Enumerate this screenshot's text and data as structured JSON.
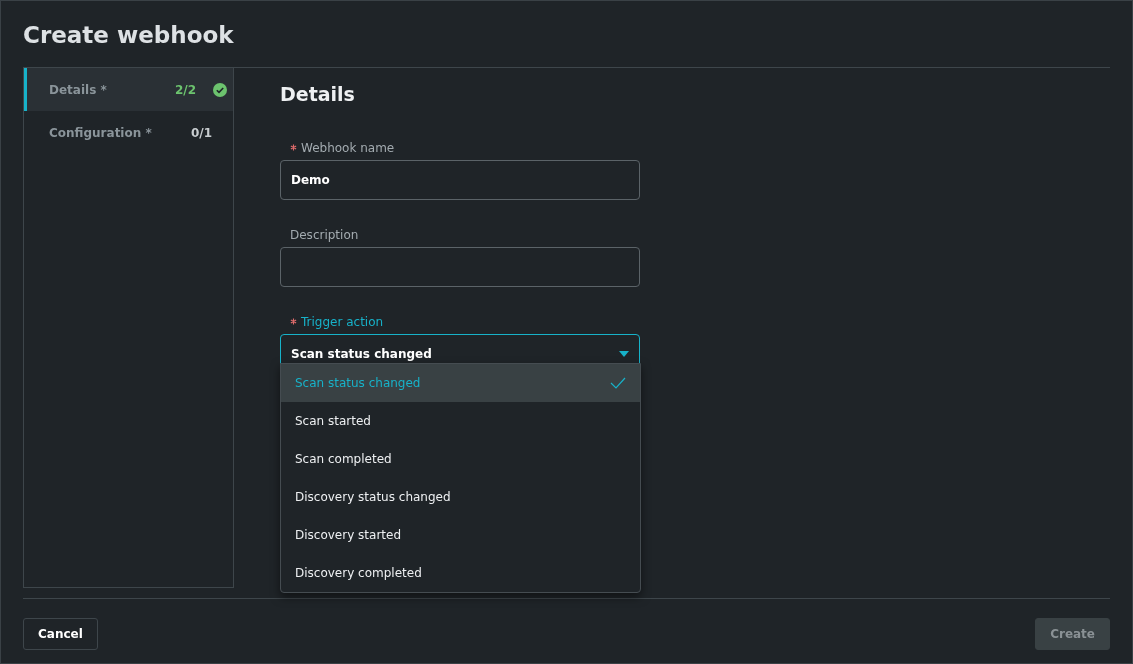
{
  "dialog": {
    "title": "Create webhook"
  },
  "steps": [
    {
      "label": "Details *",
      "count": "2/2",
      "selected": true,
      "complete": true
    },
    {
      "label": "Configuration *",
      "count": "0/1",
      "selected": false,
      "complete": false
    }
  ],
  "section_title": "Details",
  "fields": [
    {
      "kind": "text",
      "label": "Webhook name",
      "required": true,
      "focused": false,
      "value": "Demo"
    },
    {
      "kind": "text",
      "label": "Description",
      "required": false,
      "focused": false
    },
    {
      "kind": "select",
      "label": "Trigger action",
      "required": true,
      "focused": true,
      "value": "Scan status changed",
      "expanded": true,
      "options": [
        {
          "label": "Scan status changed",
          "selected": true
        },
        {
          "label": "Scan started",
          "selected": false
        },
        {
          "label": "Scan completed",
          "selected": false
        },
        {
          "label": "Discovery status changed",
          "selected": false
        },
        {
          "label": "Discovery started",
          "selected": false
        },
        {
          "label": "Discovery completed",
          "selected": false
        }
      ]
    }
  ],
  "buttons": [
    {
      "label": "Cancel",
      "disabled": false
    },
    {
      "label": "Create",
      "disabled": true
    }
  ]
}
